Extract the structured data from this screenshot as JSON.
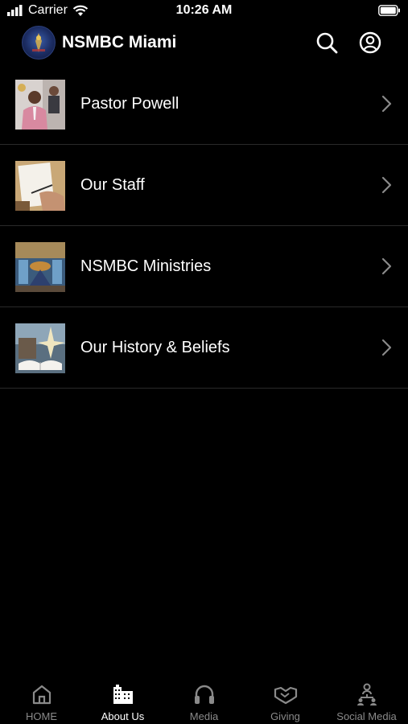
{
  "status_bar": {
    "carrier": "Carrier",
    "time": "10:26 AM"
  },
  "header": {
    "title": "NSMBC Miami"
  },
  "list": [
    {
      "label": "Pastor Powell"
    },
    {
      "label": "Our Staff"
    },
    {
      "label": "NSMBC Ministries"
    },
    {
      "label": "Our History & Beliefs"
    }
  ],
  "tabs": [
    {
      "label": "HOME",
      "icon": "home-icon"
    },
    {
      "label": "About Us",
      "icon": "building-icon",
      "active": true
    },
    {
      "label": "Media",
      "icon": "headphones-icon"
    },
    {
      "label": "Giving",
      "icon": "handshake-icon"
    },
    {
      "label": "Social Media",
      "icon": "people-icon"
    }
  ],
  "colors": {
    "background": "#000000",
    "text": "#ffffff",
    "inactive_tab": "#8a8a8a",
    "divider": "#2a2a2a"
  }
}
